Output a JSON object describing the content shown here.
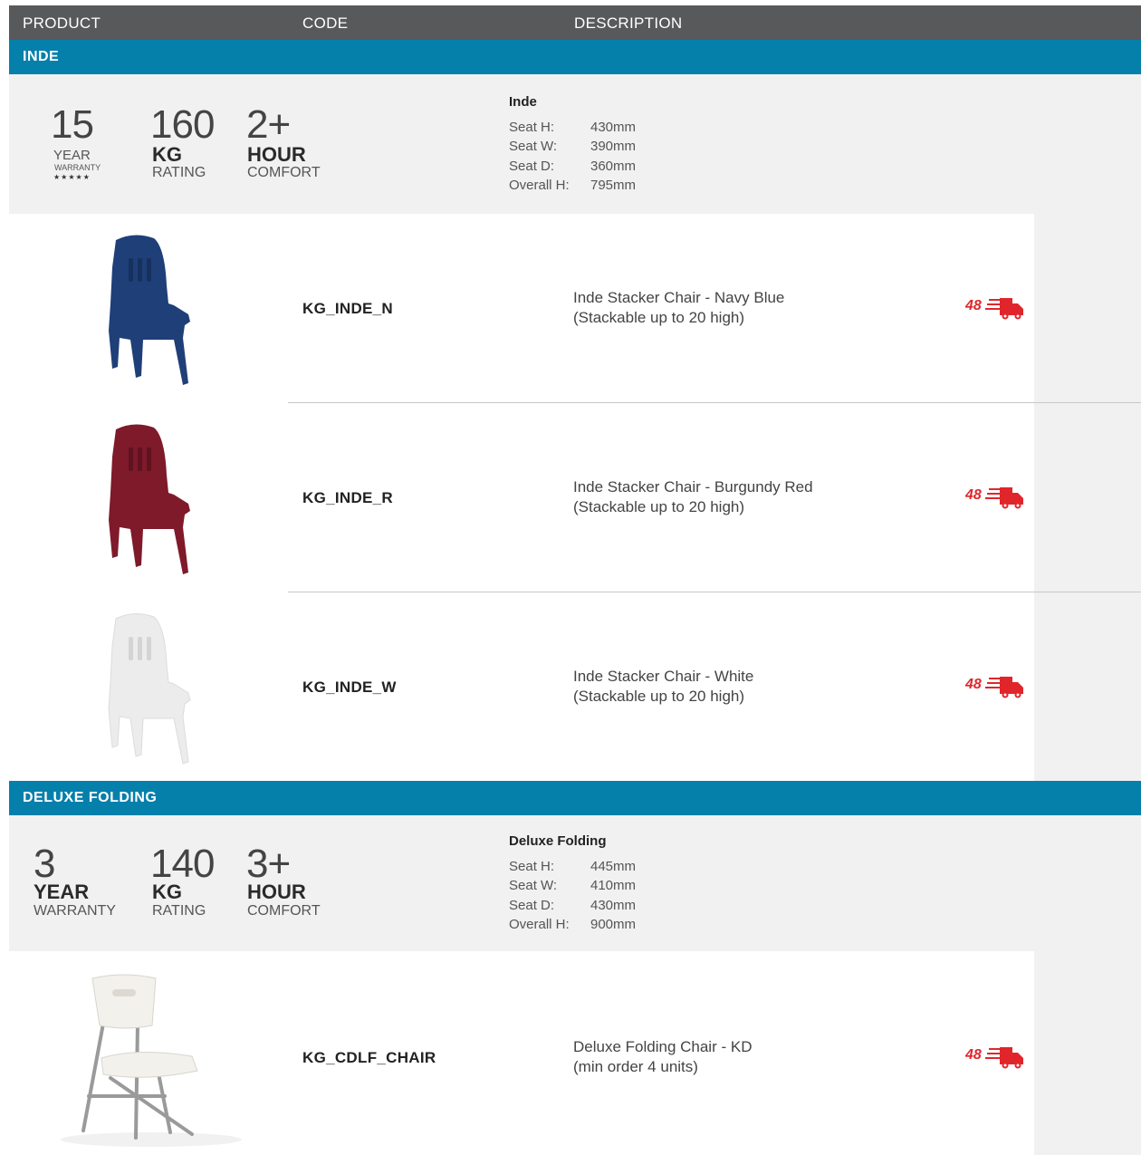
{
  "header": {
    "columns": [
      "PRODUCT",
      "CODE",
      "DESCRIPTION"
    ]
  },
  "sections": [
    {
      "title": "INDE",
      "badges": {
        "warranty": {
          "number": "15",
          "line1": "YEAR",
          "line2": "WARRANTY",
          "stars": "★★★★★"
        },
        "rating": {
          "number": "160",
          "unit": "KG",
          "label": "RATING"
        },
        "comfort": {
          "number": "2+",
          "unit": "HOUR",
          "label": "COMFORT"
        }
      },
      "spec": {
        "name": "Inde",
        "rows": [
          {
            "k": "Seat H:",
            "v": "430mm"
          },
          {
            "k": "Seat W:",
            "v": "390mm"
          },
          {
            "k": "Seat D:",
            "v": "360mm"
          },
          {
            "k": "Overall H:",
            "v": "795mm"
          }
        ]
      },
      "products": [
        {
          "code": "KG_INDE_N",
          "desc1": "Inde Stacker Chair - Navy Blue",
          "desc2": "(Stackable up to 20 high)",
          "color": "#1f3f78",
          "ship": "48"
        },
        {
          "code": "KG_INDE_R",
          "desc1": "Inde Stacker Chair - Burgundy Red",
          "desc2": "(Stackable up to 20 high)",
          "color": "#7e1a2a",
          "ship": "48"
        },
        {
          "code": "KG_INDE_W",
          "desc1": "Inde Stacker Chair - White",
          "desc2": "(Stackable up to 20 high)",
          "color": "#e9e9e9",
          "ship": "48"
        }
      ]
    },
    {
      "title": "DELUXE FOLDING",
      "badges": {
        "warranty": {
          "number": "3",
          "unit": "YEAR",
          "label": "WARRANTY"
        },
        "rating": {
          "number": "140",
          "unit": "KG",
          "label": "RATING"
        },
        "comfort": {
          "number": "3+",
          "unit": "HOUR",
          "label": "COMFORT"
        }
      },
      "spec": {
        "name": "Deluxe Folding",
        "rows": [
          {
            "k": "Seat H:",
            "v": "445mm"
          },
          {
            "k": "Seat W:",
            "v": "410mm"
          },
          {
            "k": "Seat D:",
            "v": "430mm"
          },
          {
            "k": "Overall H:",
            "v": "900mm"
          }
        ]
      },
      "products": [
        {
          "code": "KG_CDLF_CHAIR",
          "desc1": "Deluxe Folding Chair - KD",
          "desc2": "(min order 4 units)",
          "ship": "48"
        }
      ]
    }
  ],
  "colors": {
    "header_bg": "#58595b",
    "section_bar": "#0580ab",
    "panel_bg": "#f1f1f1",
    "shipping_red": "#e0262b"
  },
  "icons": {
    "shipping": "delivery-truck-icon"
  }
}
